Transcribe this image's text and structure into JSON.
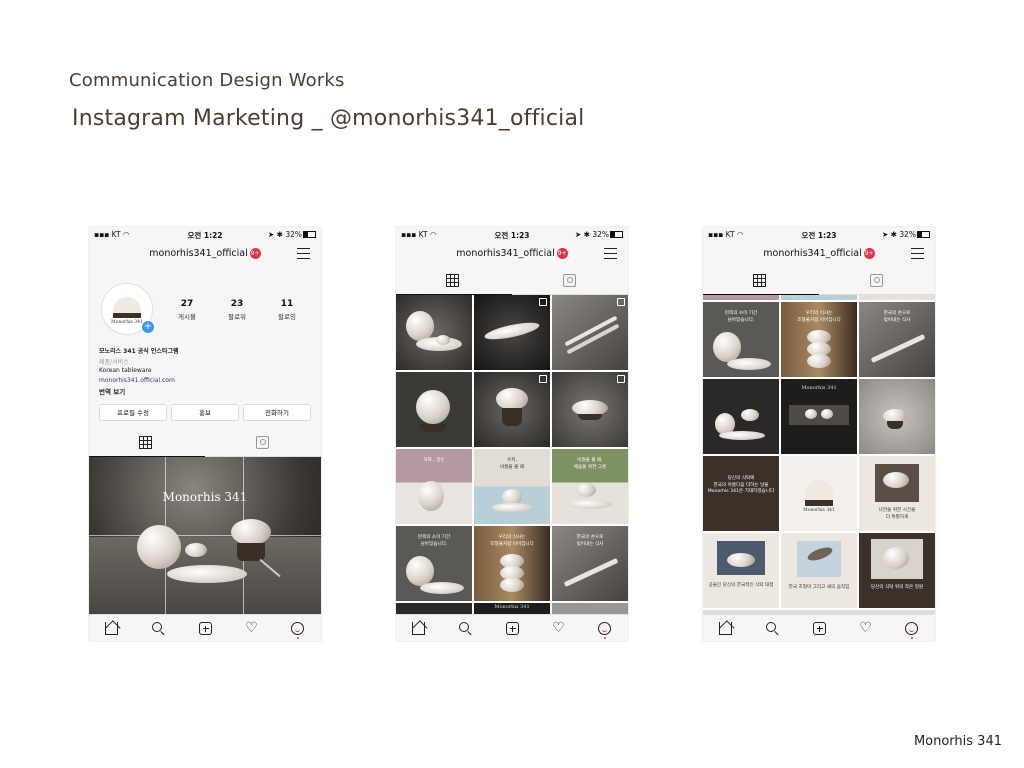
{
  "header": {
    "title": "Communication Design Works",
    "subtitle": "Instagram Marketing _ @monorhis341_official"
  },
  "footer": {
    "brand": "Monorhis 341"
  },
  "colors": {
    "text_brown": "#4b3e2f",
    "notif_red": "#e0334a",
    "accent_blue": "#3897f0",
    "dark_brown": "#3a2f27"
  },
  "phones": [
    {
      "status": {
        "carrier": "KT",
        "time": "오전 1:22",
        "battery": "32%"
      },
      "username": "monorhis341_official",
      "notif_count": "9+",
      "profile": {
        "avatar_brand": "Monorhis 341",
        "stats": [
          {
            "value": "27",
            "label": "게시물"
          },
          {
            "value": "23",
            "label": "팔로워"
          },
          {
            "value": "11",
            "label": "팔로잉"
          }
        ],
        "name": "모노리스 341 공식 인스타그램",
        "category": "제품/서비스",
        "description": "Korean tableware",
        "link": "monorhis341.official.com",
        "translate": "번역 보기",
        "buttons": [
          "프로필 수정",
          "홍보",
          "전화하기"
        ]
      },
      "hero_text": "Monorhis 341"
    },
    {
      "status": {
        "carrier": "KT",
        "time": "오전 1:23",
        "battery": "32%"
      },
      "username": "monorhis341_official",
      "notif_count": "9+",
      "captions": [
        "하와 , 짓는",
        "수저,\n비웠을 볼 때",
        "비웠을 볼 때,\n채움을 위한 그릇",
        "왼쪽의 소이 기간\n남아있습니다.",
        "우리의 식사는\n조형물처럼 이어집니다",
        "한국의 손으로\n빚어내는 식사"
      ],
      "overlay_brand": "Monorhis 341"
    },
    {
      "status": {
        "carrier": "KT",
        "time": "오전 1:23",
        "battery": "32%"
      },
      "username": "monorhis341_official",
      "notif_count": "9+",
      "captions": [
        "왼쪽의 소이 기간\n남아있습니다.",
        "우리의 식사는\n조형물처럼 이어집니다",
        "한국의 손으로\n빚어내는 식사",
        "당신의 식탁에\n한국의 아름다움 더하는 날을\nMonorhis 341은 기대하겠습니다",
        "Monorhis 341",
        "나만을 위한 시간을\n더 특별하게",
        "공들인 당신의 한국적인 식탁 대접",
        "한국 조형미 그리고 새의 움직임",
        "당신의 식탁 위의 작은 정원"
      ],
      "overlay_brand": "Monorhis 341"
    }
  ]
}
